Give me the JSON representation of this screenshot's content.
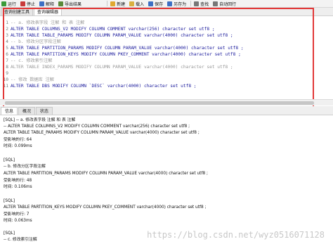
{
  "toolbar": {
    "left_items": [
      {
        "label": "运行",
        "icon": "run-icon",
        "color": "#3a9b3a"
      },
      {
        "label": "停止",
        "icon": "stop-icon",
        "color": "#c83a3a"
      },
      {
        "label": "解释",
        "icon": "explain-icon",
        "color": "#3d6fc4"
      },
      {
        "label": "导出结果",
        "icon": "export-icon",
        "color": "#5a8a3a"
      }
    ],
    "right_items": [
      {
        "label": "新建",
        "icon": "new-icon",
        "color": "#e0a830"
      },
      {
        "label": "载入",
        "icon": "load-icon",
        "color": "#d9b040"
      },
      {
        "label": "保存",
        "icon": "save-icon",
        "color": "#3d6fc4"
      },
      {
        "label": "另存为",
        "icon": "save-as-icon",
        "color": "#3d6fc4"
      },
      {
        "label": "查找",
        "icon": "find-icon",
        "color": "#777777"
      },
      {
        "label": "自动回行",
        "icon": "wrap-icon",
        "color": "#777777"
      }
    ]
  },
  "tabs": {
    "builder": "查询创建工具",
    "editor": "查询编辑器"
  },
  "editor": {
    "lines": [
      {
        "num": "1",
        "text": "-- a. 修改表字段 注解 和 表 注解",
        "comment": true
      },
      {
        "num": "2",
        "text": "ALTER TABLE COLUMNS_V2 MODIFY COLUMN COMMENT varchar(256) character set utf8 ;",
        "comment": false
      },
      {
        "num": "3",
        "text": "ALTER TABLE TABLE_PARAMS MODIFY COLUMN PARAM_VALUE varchar(4000) character set utf8 ;",
        "comment": false
      },
      {
        "num": "4",
        "text": "-- b. 修改分区字段注解",
        "comment": true
      },
      {
        "num": "5",
        "text": "ALTER TABLE PARTITION_PARAMS MODIFY COLUMN PARAM_VALUE varchar(4000) character set utf8 ;",
        "comment": false
      },
      {
        "num": "6",
        "text": "ALTER TABLE PARTITION_KEYS MODIFY COLUMN PKEY_COMMENT varchar(4000) character set utf8 ;",
        "comment": false
      },
      {
        "num": "7",
        "text": "-- c. 修改索引注解",
        "comment": true
      },
      {
        "num": "8",
        "text": "ALTER TABLE INDEX_PARAMS MODIFY COLUMN PARAM_VALUE varchar(4000) character set utf8 ;",
        "comment": true
      },
      {
        "num": "9",
        "text": "",
        "comment": true
      },
      {
        "num": "10",
        "text": "-- 修改 数据库 注解",
        "comment": true
      },
      {
        "num": "11",
        "text": "ALTER TABLE DBS MODIFY COLUMN `DESC` varchar(4000) character set utf8 ;",
        "comment": false
      }
    ]
  },
  "result_tabs": {
    "info": "信息",
    "overview": "概况",
    "status": "状态"
  },
  "output": {
    "lines": [
      "[SQL] -- a. 修改表字段 注解 和 表 注解",
      "-- ALTER TABLE COLUMNS_V2 MODIFY COLUMN COMMENT varchar(256) character set utf8 ;",
      "ALTER TABLE TABLE_PARAMS MODIFY COLUMN PARAM_VALUE varchar(4000) character set utf8 ;",
      "受影响的行: 64",
      "时间: 0.099ms",
      "",
      "[SQL]",
      "-- b. 修改分区字段注解",
      "ALTER TABLE PARTITION_PARAMS MODIFY COLUMN PARAM_VALUE varchar(4000) character set utf8 ;",
      "受影响的行: 48",
      "时间: 0.106ms",
      "",
      "[SQL]",
      "ALTER TABLE PARTITION_KEYS MODIFY COLUMN PKEY_COMMENT varchar(4000) character set utf8 ;",
      "受影响的行: 7",
      "时间: 0.063ms",
      "",
      "[SQL]",
      "-- c. 修改索引注解"
    ]
  },
  "watermark": "https://blog.csdn.net/wyz0516071128",
  "colors": {
    "highlight_border": "#e23838",
    "sql_text": "#1a1a9c",
    "comment_text": "#9a9a9a"
  }
}
